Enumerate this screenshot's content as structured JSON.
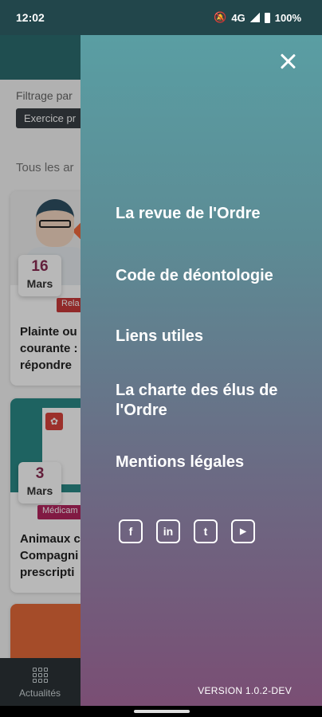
{
  "status_bar": {
    "time": "12:02",
    "network": "4G",
    "battery": "100%"
  },
  "background": {
    "filter_label": "Filtrage par",
    "filter_chip": "Exercice pr",
    "section_label": "Tous les ar",
    "cards": [
      {
        "day": "16",
        "month": "Mars",
        "tag": "Rela",
        "title": "Plainte ou courante : répondre"
      },
      {
        "day": "3",
        "month": "Mars",
        "tag": "Médicam",
        "title": "Animaux c Compagni prescripti"
      }
    ],
    "bottom_nav": {
      "label": "Actualités"
    }
  },
  "drawer": {
    "menu": [
      "La revue de l'Ordre",
      "Code de déontologie",
      "Liens utiles",
      "La charte des élus de l'Ordre",
      "Mentions légales"
    ],
    "socials": [
      "f",
      "in",
      "t",
      "▶"
    ],
    "version": "VERSION 1.0.2-DEV"
  }
}
